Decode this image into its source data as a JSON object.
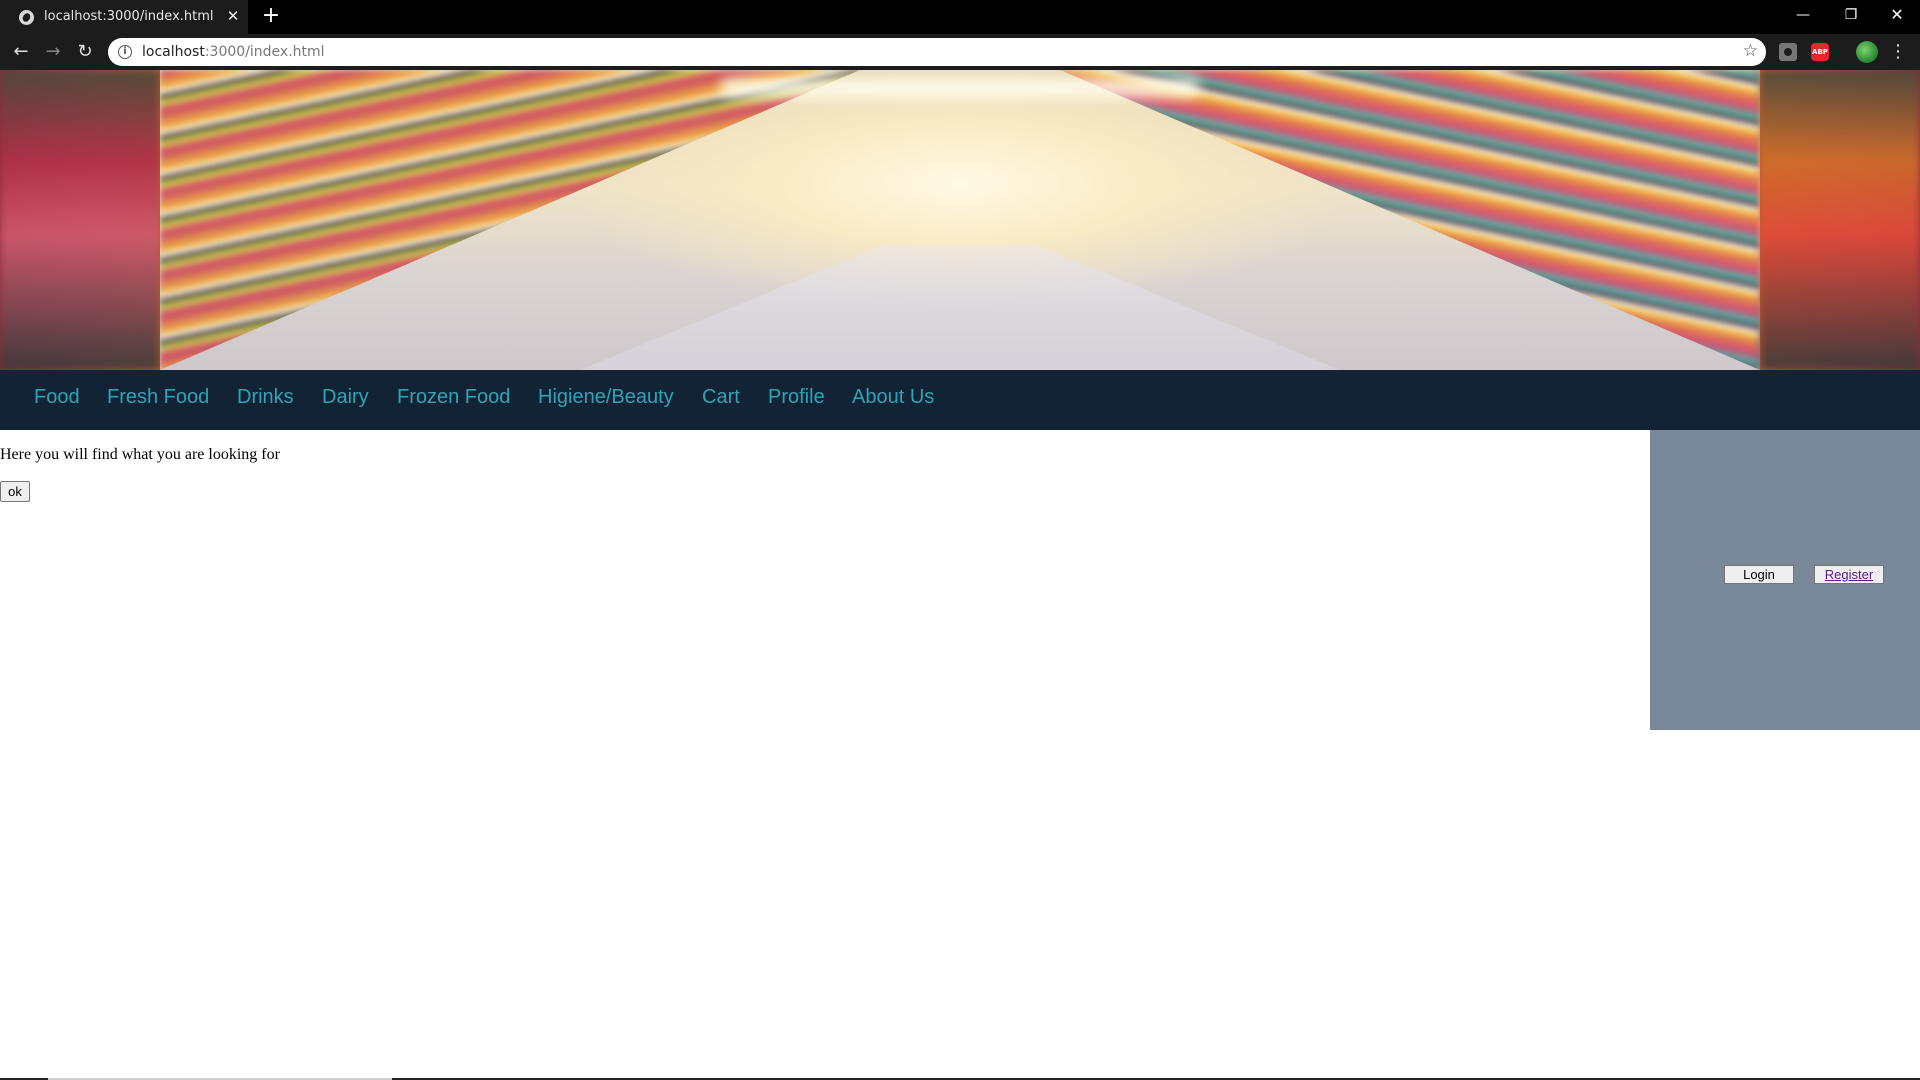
{
  "browser": {
    "tab_title": "localhost:3000/index.html",
    "tab_close_glyph": "✕",
    "new_tab_glyph": "+",
    "url_host": "localhost",
    "url_path": ":3000/index.html",
    "window_controls": {
      "minimize": "—",
      "restore": "❐",
      "close": "✕"
    },
    "nav": {
      "back": "←",
      "forward": "→",
      "reload": "↻"
    },
    "star_glyph": "☆",
    "abp_label": "ABP",
    "menu_glyph": "⋮"
  },
  "icons": [
    "globe-icon",
    "info-icon",
    "star-icon",
    "camera-icon",
    "adblock-icon",
    "profile-avatar",
    "menu-icon"
  ],
  "colors": {
    "navbar_bg": "#122336",
    "nav_link": "#2fa4b6",
    "side_panel_bg": "#7a8999",
    "register_link": "#551a8b"
  },
  "nav_menu": {
    "items": [
      {
        "label": "Food"
      },
      {
        "label": "Fresh Food"
      },
      {
        "label": "Drinks"
      },
      {
        "label": "Dairy"
      },
      {
        "label": "Frozen Food"
      },
      {
        "label": "Higiene/Beauty"
      },
      {
        "label": "Cart"
      },
      {
        "label": "Profile"
      },
      {
        "label": "About Us"
      }
    ]
  },
  "main": {
    "tagline": "Here you will find what you are looking for",
    "ok_label": "ok"
  },
  "auth": {
    "login_label": "Login",
    "register_label": "Register"
  }
}
